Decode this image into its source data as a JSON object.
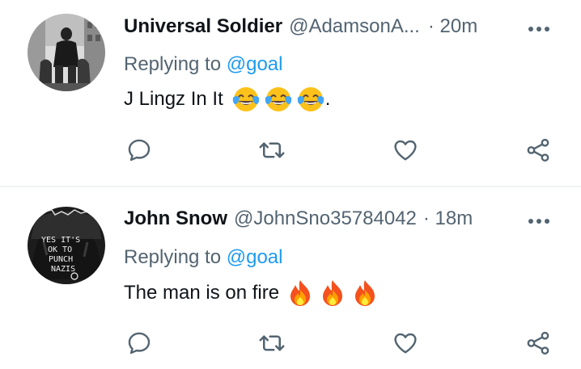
{
  "tweets": [
    {
      "name": "Universal Soldier",
      "handle": "@AdamsonA...",
      "time": "· 20m",
      "replying_prefix": "Replying to",
      "replying_to": "@goal",
      "text": "J Lingz In It",
      "emojis": [
        "face-with-tears-of-joy",
        "face-with-tears-of-joy",
        "face-with-tears-of-joy"
      ],
      "text_suffix": "."
    },
    {
      "name": "John Snow",
      "handle": "@JohnSno35784042",
      "time": "· 18m",
      "replying_prefix": "Replying to",
      "replying_to": "@goal",
      "text": "The man is on fire",
      "emojis": [
        "fire",
        "fire",
        "fire"
      ],
      "text_suffix": "",
      "avatar_text": [
        "YES IT'S",
        "OK TO",
        "PUNCH",
        "NAZIS"
      ]
    }
  ],
  "icons": {
    "more": "more-horizontal-icon",
    "reply": "reply-icon",
    "retweet": "retweet-icon",
    "like": "heart-icon",
    "share": "share-icon"
  },
  "colors": {
    "accent": "#1d9bf0",
    "secondary_text": "#536471",
    "icon": "#536471",
    "divider": "#eff3f4"
  }
}
